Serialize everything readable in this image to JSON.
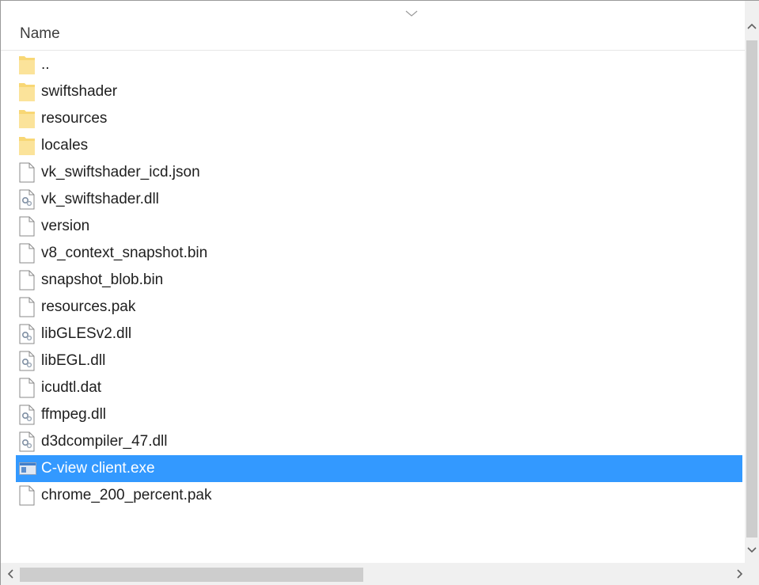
{
  "header": {
    "column_name": "Name",
    "sort_icon": "chevron-down-icon"
  },
  "files": [
    {
      "name": "..",
      "type": "folder",
      "icon": "folder-icon",
      "selected": false
    },
    {
      "name": "swiftshader",
      "type": "folder",
      "icon": "folder-icon",
      "selected": false
    },
    {
      "name": "resources",
      "type": "folder",
      "icon": "folder-icon",
      "selected": false
    },
    {
      "name": "locales",
      "type": "folder",
      "icon": "folder-icon",
      "selected": false
    },
    {
      "name": "vk_swiftshader_icd.json",
      "type": "file",
      "icon": "file-icon",
      "selected": false
    },
    {
      "name": "vk_swiftshader.dll",
      "type": "dll",
      "icon": "dll-file-icon",
      "selected": false
    },
    {
      "name": "version",
      "type": "file",
      "icon": "file-icon",
      "selected": false
    },
    {
      "name": "v8_context_snapshot.bin",
      "type": "file",
      "icon": "file-icon",
      "selected": false
    },
    {
      "name": "snapshot_blob.bin",
      "type": "file",
      "icon": "file-icon",
      "selected": false
    },
    {
      "name": "resources.pak",
      "type": "file",
      "icon": "file-icon",
      "selected": false
    },
    {
      "name": "libGLESv2.dll",
      "type": "dll",
      "icon": "dll-file-icon",
      "selected": false
    },
    {
      "name": "libEGL.dll",
      "type": "dll",
      "icon": "dll-file-icon",
      "selected": false
    },
    {
      "name": "icudtl.dat",
      "type": "file",
      "icon": "file-icon",
      "selected": false
    },
    {
      "name": "ffmpeg.dll",
      "type": "dll",
      "icon": "dll-file-icon",
      "selected": false
    },
    {
      "name": "d3dcompiler_47.dll",
      "type": "dll",
      "icon": "dll-file-icon",
      "selected": false
    },
    {
      "name": "C-view client.exe",
      "type": "exe",
      "icon": "application-icon",
      "selected": true
    },
    {
      "name": "chrome_200_percent.pak",
      "type": "file",
      "icon": "file-icon",
      "selected": false
    }
  ],
  "colors": {
    "selection": "#3399ff",
    "folder": "#f8d775",
    "scroll_track": "#f0f0f0",
    "scroll_thumb": "#cdcdcd"
  },
  "scrollbars": {
    "up_icon": "scroll-up-arrow-icon",
    "down_icon": "scroll-down-arrow-icon",
    "left_icon": "scroll-left-arrow-icon",
    "right_icon": "scroll-right-arrow-icon"
  }
}
